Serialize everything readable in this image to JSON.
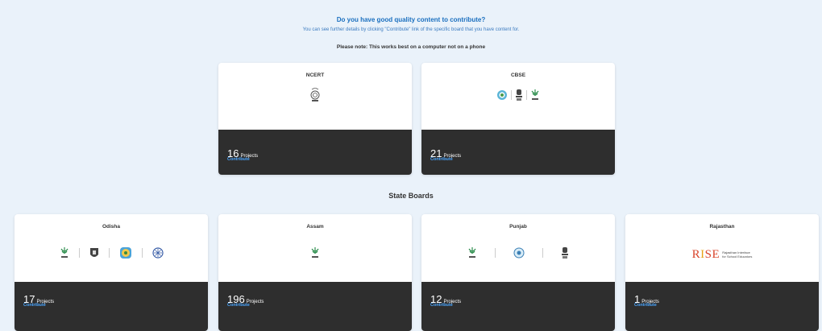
{
  "header": {
    "question": "Do you have good quality content to contribute?",
    "subtitle": "You can see further details by clicking \"Contribute\" link of the specific board that you have content for.",
    "note": "Please note: This works best on a computer not on a phone"
  },
  "section_title": "State Boards",
  "cards": [
    {
      "name": "NCERT",
      "count": "16",
      "count_label": "Projects",
      "contribute": "Contribute",
      "logos": [
        "ncert-emblem-icon"
      ]
    },
    {
      "name": "CBSE",
      "count": "21",
      "count_label": "Projects",
      "contribute": "Contribute",
      "logos": [
        "cbse-seal-icon",
        "national-emblem-icon",
        "diksha-icon"
      ]
    },
    {
      "name": "Odisha",
      "count": "17",
      "count_label": "Projects",
      "contribute": "Contribute",
      "logos": [
        "diksha-icon",
        "shield-icon",
        "odisha-board-icon",
        "odisha-seal-icon"
      ]
    },
    {
      "name": "Assam",
      "count": "196",
      "count_label": "Projects",
      "contribute": "Contribute",
      "logos": [
        "diksha-icon"
      ]
    },
    {
      "name": "Punjab",
      "count": "12",
      "count_label": "Projects",
      "contribute": "Contribute",
      "logos": [
        "diksha-icon",
        "punjab-seal-icon",
        "national-emblem-icon"
      ]
    },
    {
      "name": "Rajasthan",
      "count": "1",
      "count_label": "Projects",
      "contribute": "Contribute",
      "logos": [
        "rise-logo"
      ],
      "rise_caption_1": "Rajasthan Interface",
      "rise_caption_2": "for School Educators",
      "rise_mark": "RISE"
    }
  ]
}
